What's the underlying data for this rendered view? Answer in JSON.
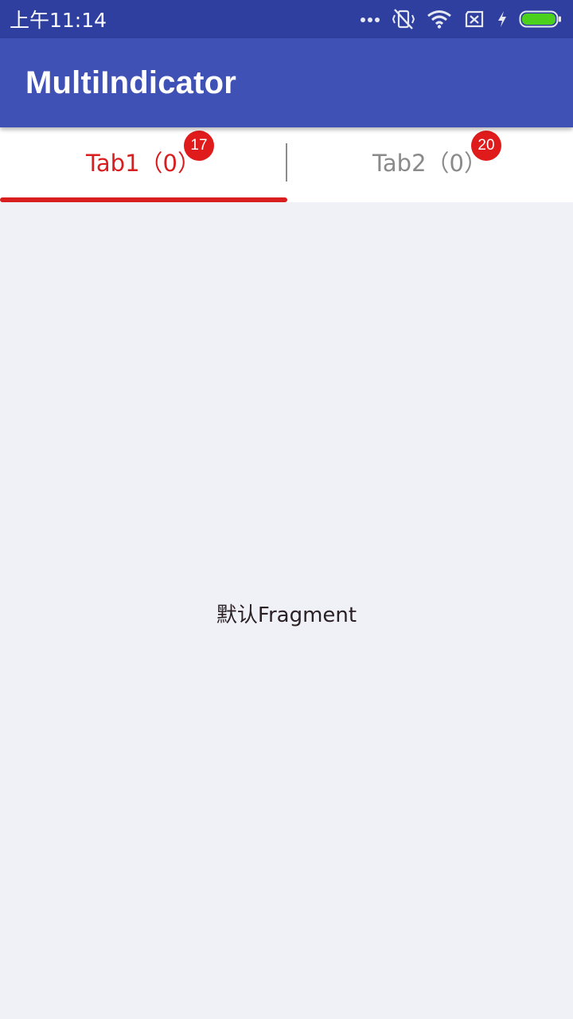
{
  "status_bar": {
    "time": "上午11:14",
    "icons": [
      "more-dots-icon",
      "vibrate-off-icon",
      "wifi-icon",
      "no-sim-icon",
      "charging-bolt-icon",
      "battery-icon"
    ],
    "battery_color": "#4cd01e"
  },
  "app_bar": {
    "title": "MultiIndicator",
    "color": "#3f51b5"
  },
  "tabs": [
    {
      "label": "Tab1（0）",
      "badge": "17",
      "selected": true
    },
    {
      "label": "Tab2（0）",
      "badge": "20",
      "selected": false
    }
  ],
  "colors": {
    "accent": "#d81e1e",
    "badge": "#e01b1b",
    "inactive_tab": "#8a8a8a",
    "background": "#eff1f6"
  },
  "content": {
    "text": "默认Fragment"
  }
}
